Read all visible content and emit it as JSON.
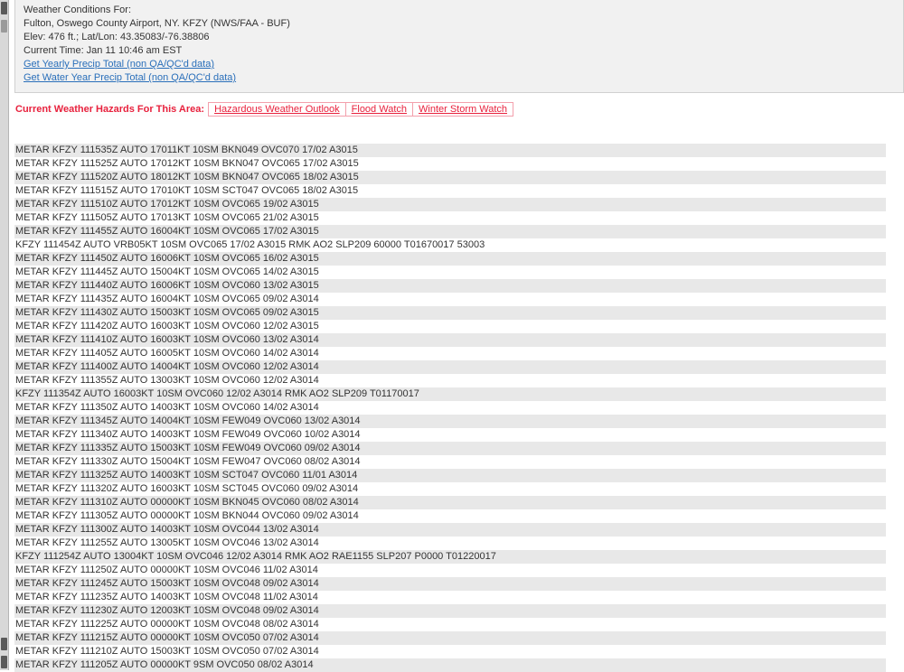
{
  "header": {
    "title": "Weather Conditions For:",
    "station": "Fulton, Oswego County Airport, NY. KFZY (NWS/FAA   - BUF)",
    "elev": "Elev: 476 ft.; Lat/Lon: 43.35083/-76.38806",
    "current_time": "Current Time: Jan 11 10:46 am EST",
    "yearly_link": "Get Yearly Precip Total (non QA/QC'd data)",
    "water_year_link": "Get Water Year Precip Total (non QA/QC'd data)"
  },
  "hazards": {
    "label": "Current Weather Hazards For This Area:",
    "links": [
      "Hazardous Weather Outlook",
      "Flood Watch",
      "Winter Storm Watch"
    ]
  },
  "colors": {
    "hazard_red": "#e8213d",
    "link_blue": "#2a6fba",
    "row_stripe": "#e8e8e8"
  },
  "observations": [
    "METAR KFZY 111535Z AUTO 17011KT 10SM BKN049 OVC070 17/02 A3015",
    "METAR KFZY 111525Z AUTO 17012KT 10SM BKN047 OVC065 17/02 A3015",
    "METAR KFZY 111520Z AUTO 18012KT 10SM BKN047 OVC065 18/02 A3015",
    "METAR KFZY 111515Z AUTO 17010KT 10SM SCT047 OVC065 18/02 A3015",
    "METAR KFZY 111510Z AUTO 17012KT 10SM OVC065 19/02 A3015",
    "METAR KFZY 111505Z AUTO 17013KT 10SM OVC065 21/02 A3015",
    "METAR KFZY 111455Z AUTO 16004KT 10SM OVC065 17/02 A3015",
    "KFZY 111454Z AUTO VRB05KT 10SM OVC065 17/02 A3015 RMK AO2 SLP209 60000 T01670017 53003",
    "METAR KFZY 111450Z AUTO 16006KT 10SM OVC065 16/02 A3015",
    "METAR KFZY 111445Z AUTO 15004KT 10SM OVC065 14/02 A3015",
    "METAR KFZY 111440Z AUTO 16006KT 10SM OVC060 13/02 A3015",
    "METAR KFZY 111435Z AUTO 16004KT 10SM OVC065 09/02 A3014",
    "METAR KFZY 111430Z AUTO 15003KT 10SM OVC065 09/02 A3015",
    "METAR KFZY 111420Z AUTO 16003KT 10SM OVC060 12/02 A3015",
    "METAR KFZY 111410Z AUTO 16003KT 10SM OVC060 13/02 A3014",
    "METAR KFZY 111405Z AUTO 16005KT 10SM OVC060 14/02 A3014",
    "METAR KFZY 111400Z AUTO 14004KT 10SM OVC060 12/02 A3014",
    "METAR KFZY 111355Z AUTO 13003KT 10SM OVC060 12/02 A3014",
    "KFZY 111354Z AUTO 16003KT 10SM OVC060 12/02 A3014 RMK AO2 SLP209 T01170017",
    "METAR KFZY 111350Z AUTO 14003KT 10SM OVC060 14/02 A3014",
    "METAR KFZY 111345Z AUTO 14004KT 10SM FEW049 OVC060 13/02 A3014",
    "METAR KFZY 111340Z AUTO 14003KT 10SM FEW049 OVC060 10/02 A3014",
    "METAR KFZY 111335Z AUTO 15003KT 10SM FEW049 OVC060 09/02 A3014",
    "METAR KFZY 111330Z AUTO 15004KT 10SM FEW047 OVC060 08/02 A3014",
    "METAR KFZY 111325Z AUTO 14003KT 10SM SCT047 OVC060 11/01 A3014",
    "METAR KFZY 111320Z AUTO 16003KT 10SM SCT045 OVC060 09/02 A3014",
    "METAR KFZY 111310Z AUTO 00000KT 10SM BKN045 OVC060 08/02 A3014",
    "METAR KFZY 111305Z AUTO 00000KT 10SM BKN044 OVC060 09/02 A3014",
    "METAR KFZY 111300Z AUTO 14003KT 10SM OVC044 13/02 A3014",
    "METAR KFZY 111255Z AUTO 13005KT 10SM OVC046 13/02 A3014",
    "KFZY 111254Z AUTO 13004KT 10SM OVC046 12/02 A3014 RMK AO2 RAE1155 SLP207 P0000 T01220017",
    "METAR KFZY 111250Z AUTO 00000KT 10SM OVC046 11/02 A3014",
    "METAR KFZY 111245Z AUTO 15003KT 10SM OVC048 09/02 A3014",
    "METAR KFZY 111235Z AUTO 14003KT 10SM OVC048 11/02 A3014",
    "METAR KFZY 111230Z AUTO 12003KT 10SM OVC048 09/02 A3014",
    "METAR KFZY 111225Z AUTO 00000KT 10SM OVC048 08/02 A3014",
    "METAR KFZY 111215Z AUTO 00000KT 10SM OVC050 07/02 A3014",
    "METAR KFZY 111210Z AUTO 15003KT 10SM OVC050 07/02 A3014",
    "METAR KFZY 111205Z AUTO 00000KT 9SM OVC050 08/02 A3014"
  ]
}
